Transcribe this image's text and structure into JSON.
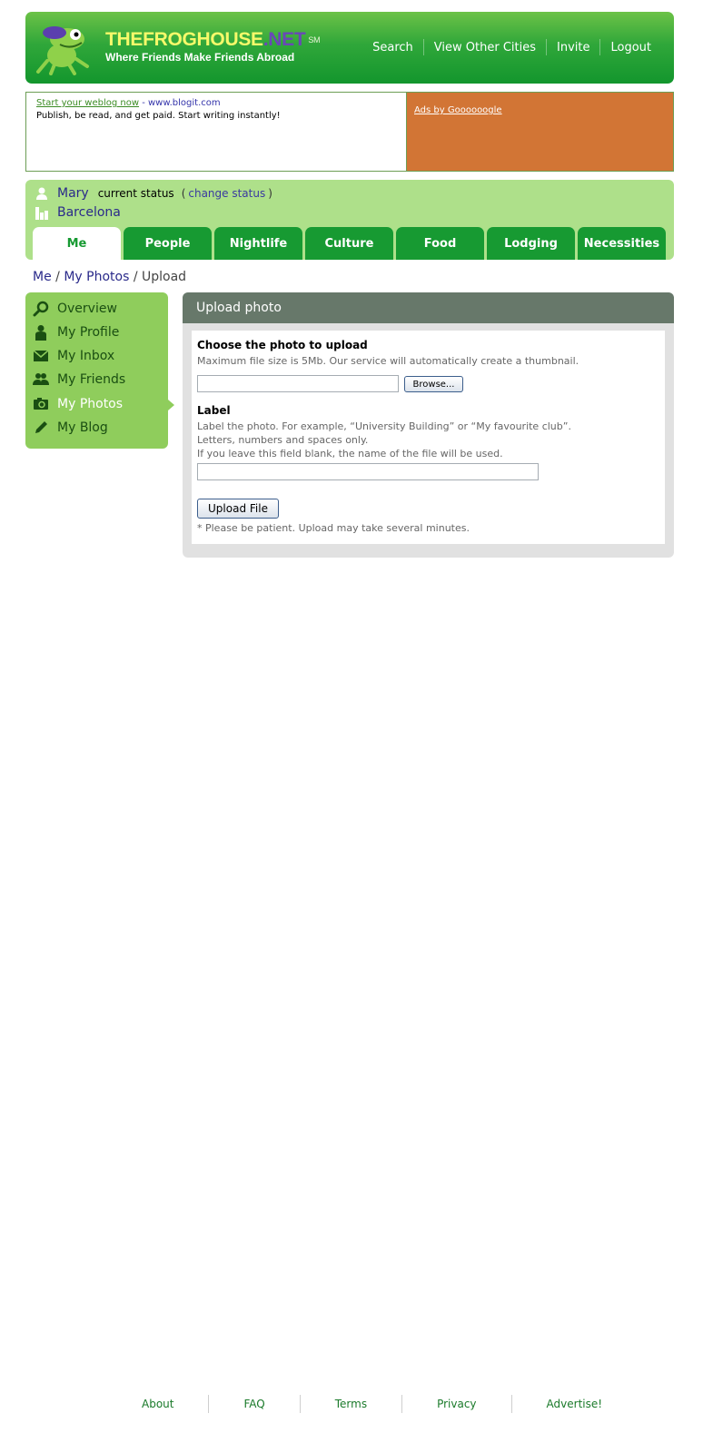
{
  "header": {
    "logo_name_part1": "THEFROGHOUSE",
    "logo_name_part2": ".NET",
    "logo_sm": "SM",
    "logo_tagline": "Where Friends Make Friends Abroad",
    "nav": [
      "Search",
      "View Other Cities",
      "Invite",
      "Logout"
    ]
  },
  "ad": {
    "link": "Start your weblog now",
    "domain": " - www.blogit.com",
    "text": "Publish, be read, and get paid. Start writing instantly!",
    "ads_by": "Ads by Goooooogle"
  },
  "status": {
    "user": "Mary",
    "label": "current status",
    "open_paren": "(",
    "change": "change status",
    "close_paren": ")",
    "city": "Barcelona"
  },
  "tabs": [
    "Me",
    "People",
    "Nightlife",
    "Culture",
    "Food",
    "Lodging",
    "Necessities"
  ],
  "breadcrumb": {
    "me": "Me",
    "sep": " / ",
    "photos": "My Photos",
    "current": "Upload"
  },
  "sidebar": {
    "items": [
      "Overview",
      "My Profile",
      "My Inbox",
      "My Friends",
      "My Photos",
      "My Blog"
    ],
    "active": "My Photos"
  },
  "upload": {
    "title": "Upload photo",
    "choose_title": "Choose the photo to upload",
    "choose_help": "Maximum file size is 5Mb. Our service will automatically create a thumbnail.",
    "browse": "Browse...",
    "label_title": "Label",
    "label_help1": "Label the photo. For example, “University Building” or “My favourite club”.",
    "label_help2": "Letters, numbers and spaces only.",
    "label_help3": "If you leave this field blank, the name of the file will be used.",
    "upload_button": "Upload File",
    "patience": "* Please be patient. Upload may take several minutes."
  },
  "footer": [
    "About",
    "FAQ",
    "Terms",
    "Privacy",
    "Advertise!"
  ],
  "colors": {
    "brand_green": "#179a32",
    "panel_green": "#aee08a",
    "sidebar_green": "#8fcd5c",
    "ad_orange": "#d27535",
    "upload_header": "#67786a"
  }
}
